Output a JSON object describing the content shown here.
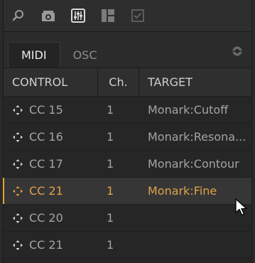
{
  "toolbar": {
    "icons": [
      "search-icon",
      "camera-icon",
      "mixer-icon",
      "layout-icon",
      "checkbox-icon"
    ]
  },
  "tabs": [
    {
      "label": "MIDI",
      "active": true
    },
    {
      "label": "OSC",
      "active": false
    }
  ],
  "table": {
    "headers": {
      "control": "CONTROL",
      "channel": "Ch.",
      "target": "TARGET"
    },
    "rows": [
      {
        "control": "CC 15",
        "channel": "1",
        "target": "Monark:Cutoff",
        "selected": false
      },
      {
        "control": "CC 16",
        "channel": "1",
        "target": "Monark:Resona...",
        "selected": false
      },
      {
        "control": "CC 17",
        "channel": "1",
        "target": "Monark:Contour",
        "selected": false
      },
      {
        "control": "CC 21",
        "channel": "1",
        "target": "Monark:Fine",
        "selected": true
      },
      {
        "control": "CC 20",
        "channel": "1",
        "target": "",
        "selected": false
      },
      {
        "control": "CC 21",
        "channel": "1",
        "target": "",
        "selected": false
      }
    ]
  },
  "colors": {
    "accent": "#e7a237",
    "text": "#a4a4a4",
    "background": "#262626"
  }
}
